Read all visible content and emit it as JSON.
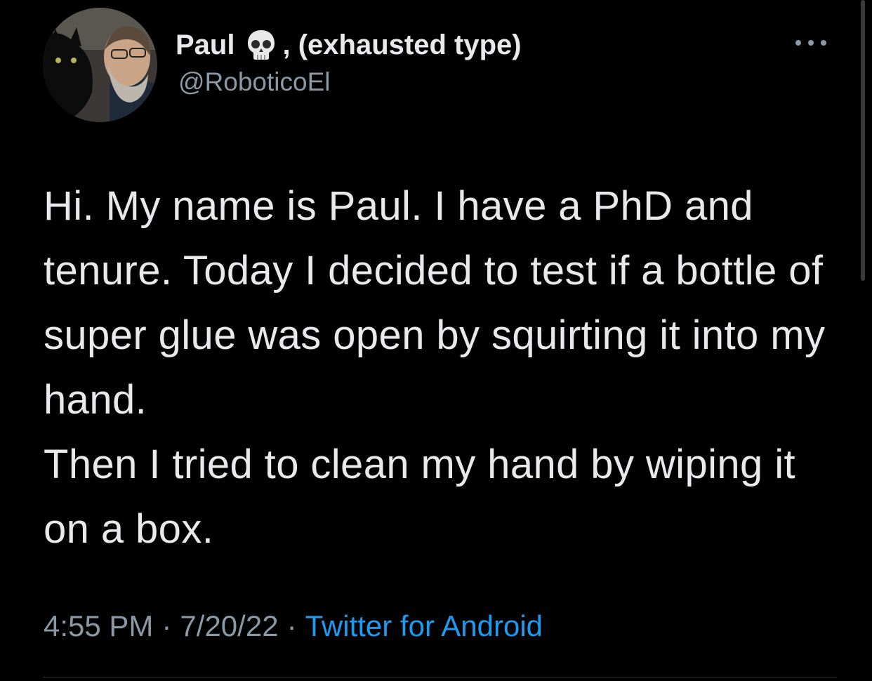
{
  "author": {
    "display_name": "Paul",
    "display_name_suffix": ", (exhausted type)",
    "name_emoji": "skull-emoji",
    "handle": "@RoboticoEl",
    "avatar": "profile-photo-man-with-black-cat"
  },
  "tweet": {
    "paragraphs": [
      "Hi. My name is Paul. I have a PhD and tenure. Today I decided to test if a bottle of super glue was open by squirting it into my hand.",
      "Then I tried to clean my hand by wiping it on a box."
    ],
    "time": "4:55 PM",
    "separator": "·",
    "date": "7/20/22",
    "source": "Twitter for Android"
  },
  "actions": {
    "more_icon": "more-horizontal-icon"
  },
  "colors": {
    "background": "#000000",
    "text_primary": "#e7e9ea",
    "text_secondary": "#8b98a5",
    "link": "#1d9bf0",
    "divider": "#2f3336"
  }
}
